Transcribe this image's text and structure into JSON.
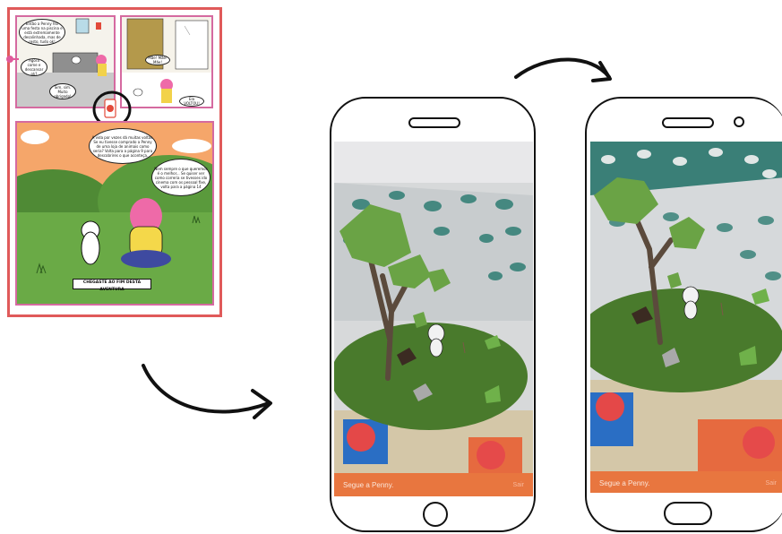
{
  "comic": {
    "bubble_1": "Então a Penny fez uma festa na piscina e está extremamente desalinhada, mas de resto, tudo ok!",
    "bubble_2": "Agora come e descansar ok?",
    "bubble_3": "Sim, sim. Muito obrigado!",
    "bubble_4": "Mãe! Mãe! Mãe!",
    "bubble_5": "Ela VOLTOU!",
    "bubble_6": "A vida por vezes dá muitas voltas. Se eu tivesse comprado a Penny de uma loja de animais como seria? Volta para a página 9 para descobrires o que aconteça.",
    "bubble_7": "Nem sempre o que queremos é o melhor... Se quiser ver como correria se tivesses ido cinema com os pessoal fixe, volta para a página 14",
    "end_caption": "CHEGASTE AO FIM DESTA AVENTURA"
  },
  "phone_left": {
    "status_text": "Segue a Penny.",
    "action_label": "Sair"
  },
  "phone_right": {
    "status_text": "Segue a Penny.",
    "action_label": "Sair"
  },
  "colors": {
    "frame_red": "#e05a5a",
    "panel_pink": "#d56aa0",
    "bar_orange": "#e8763f",
    "grass_green": "#5a8f3a",
    "tree_green": "#6aa345"
  },
  "icons": [
    "arrow-right-icon",
    "curved-arrow-icon",
    "camera-icon",
    "dog-icon"
  ]
}
